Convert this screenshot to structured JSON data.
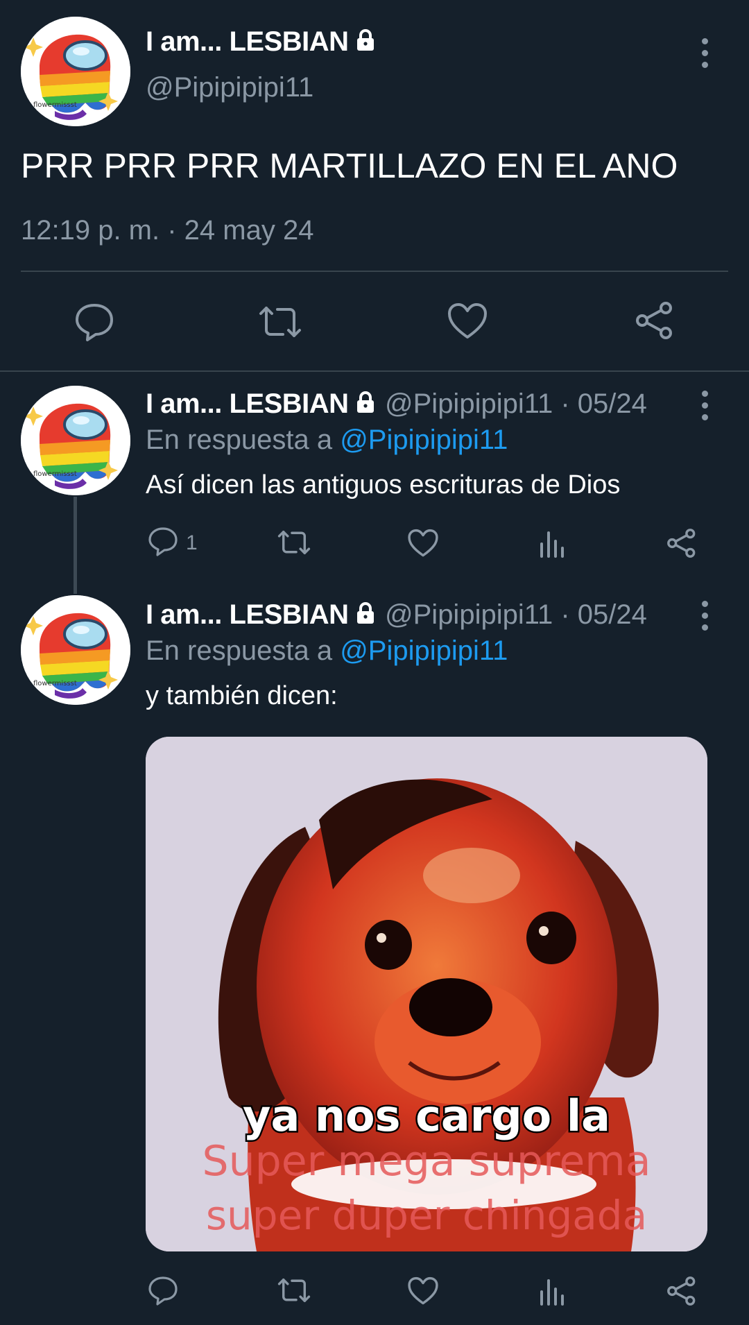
{
  "main_tweet": {
    "display_name": "I am... LESBIAN",
    "handle": "@Pipipipipi11",
    "text": "PRR PRR PRR MARTILLAZO EN EL ANO",
    "timestamp": "12:19 p. m. · 24 may 24",
    "avatar_caption": "flowermissst"
  },
  "replies": [
    {
      "display_name": "I am... LESBIAN",
      "handle_date": "@Pipipipipi11 · 05/24",
      "reply_prefix": "En respuesta a",
      "reply_to": "@Pipipipipi11",
      "text": "Así dicen las antiguos escrituras de Dios",
      "reply_count": "1",
      "avatar_caption": "flowermissst"
    },
    {
      "display_name": "I am... LESBIAN",
      "handle_date": "@Pipipipipi11 · 05/24",
      "reply_prefix": "En respuesta a",
      "reply_to": "@Pipipipipi11",
      "text": "y también dicen:",
      "avatar_caption": "flowermissst",
      "meme_text": {
        "line1": "ya nos cargo la",
        "line2": "Super mega suprema",
        "line3": "super duper chingada"
      }
    }
  ],
  "icons": {
    "reply": "reply-icon",
    "retweet": "retweet-icon",
    "like": "heart-icon",
    "views": "views-icon",
    "share": "share-icon",
    "more": "more-options-icon",
    "lock": "lock-icon"
  },
  "colors": {
    "background": "#15202b",
    "text": "#ffffff",
    "secondary": "#8b98a5",
    "link": "#1d9bf0",
    "divider": "#38444d"
  }
}
